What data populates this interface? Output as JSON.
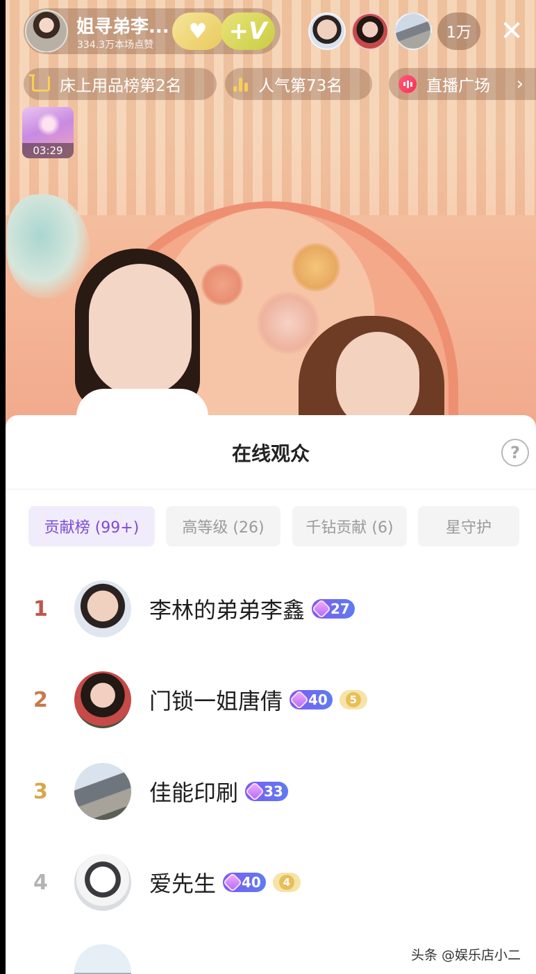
{
  "streamer": {
    "name": "姐寻弟李...",
    "likes": "334.3万本场点赞",
    "fan_v_label": "+V"
  },
  "viewers": {
    "count": "1万"
  },
  "pills": {
    "rank": "床上用品榜第2名",
    "popularity": "人气第73名",
    "plaza": "直播广场"
  },
  "gift": {
    "timer": "03:29"
  },
  "sheet": {
    "title": "在线观众",
    "help": "?",
    "tabs": [
      {
        "label": "贡献榜 (99+)",
        "active": true
      },
      {
        "label": "高等级 (26)",
        "active": false
      },
      {
        "label": "千钻贡献 (6)",
        "active": false
      },
      {
        "label": "星守护",
        "active": false
      }
    ],
    "audience": [
      {
        "rank": "1",
        "name": "李林的弟弟李鑫",
        "level": "27",
        "fan_badge": ""
      },
      {
        "rank": "2",
        "name": "门锁一姐唐倩",
        "level": "40",
        "fan_badge": "5"
      },
      {
        "rank": "3",
        "name": "佳能印刷",
        "level": "33",
        "fan_badge": ""
      },
      {
        "rank": "4",
        "name": "爱先生",
        "level": "40",
        "fan_badge": "4"
      }
    ]
  },
  "watermark": "头条 @娱乐店小二",
  "colors": {
    "rank1": "#c0564a",
    "rank2": "#c77a4a",
    "rank3": "#d6a74a",
    "rank4": "#b4b4b4",
    "accent": "#7b4bd6"
  }
}
